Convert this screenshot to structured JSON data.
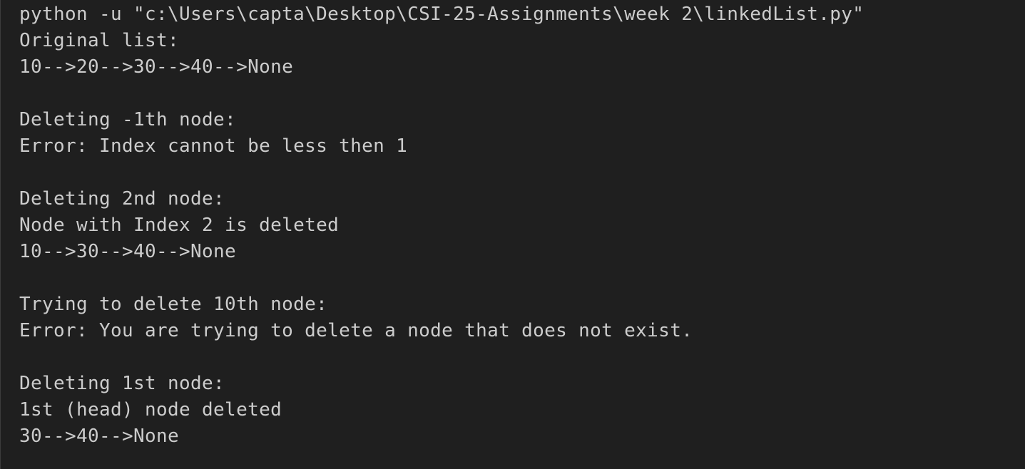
{
  "terminal": {
    "lines": [
      "python -u \"c:\\Users\\capta\\Desktop\\CSI-25-Assignments\\week 2\\linkedList.py\"",
      "Original list:",
      "10-->20-->30-->40-->None",
      "",
      "Deleting -1th node:",
      "Error: Index cannot be less then 1",
      "",
      "Deleting 2nd node:",
      "Node with Index 2 is deleted",
      "10-->30-->40-->None",
      "",
      "Trying to delete 10th node:",
      "Error: You are trying to delete a node that does not exist.",
      "",
      "Deleting 1st node:",
      "1st (head) node deleted",
      "30-->40-->None"
    ]
  }
}
